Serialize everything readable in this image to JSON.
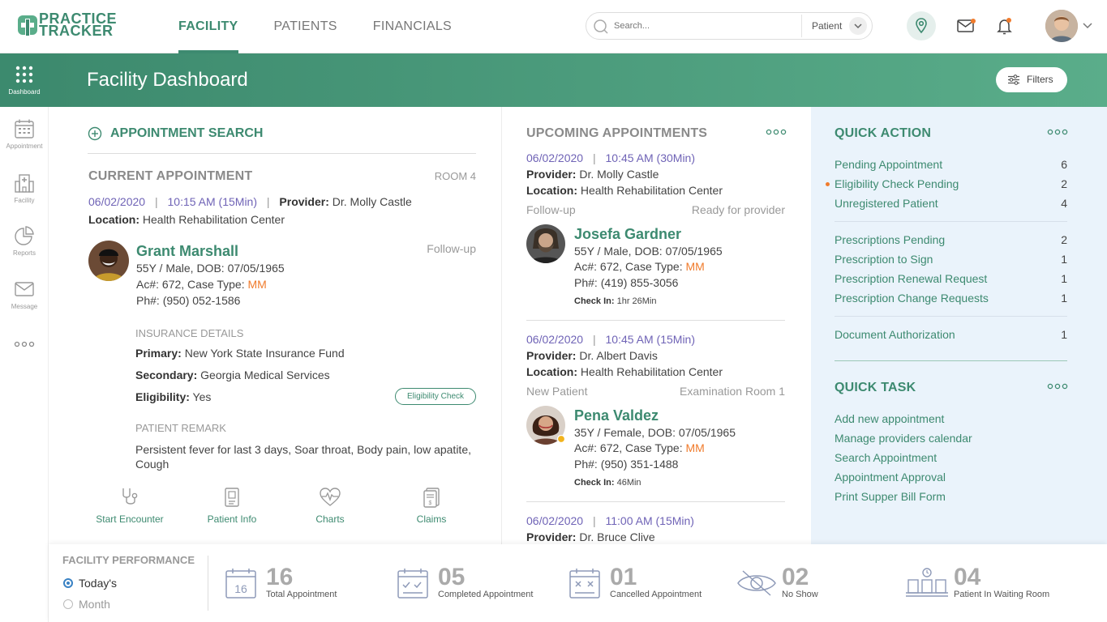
{
  "brand": {
    "line1": "PRACTICE",
    "line2": "TRACKER"
  },
  "nav": [
    {
      "label": "FACILITY",
      "active": true
    },
    {
      "label": "PATIENTS",
      "active": false
    },
    {
      "label": "FINANCIALS",
      "active": false
    }
  ],
  "search": {
    "placeholder": "Search...",
    "type": "Patient"
  },
  "sidebar": {
    "items": [
      {
        "label": "Dashboard",
        "icon": "grid-icon",
        "active": true
      },
      {
        "label": "Appointment",
        "icon": "calendar-icon"
      },
      {
        "label": "Facility",
        "icon": "hospital-icon"
      },
      {
        "label": "Reports",
        "icon": "pie-chart-icon"
      },
      {
        "label": "Message",
        "icon": "mail-icon"
      }
    ]
  },
  "header": {
    "title": "Facility Dashboard",
    "filters_label": "Filters"
  },
  "left": {
    "appt_search": "APPOINTMENT SEARCH",
    "current_title": "CURRENT APPOINTMENT",
    "room": "ROOM 4",
    "date": "06/02/2020",
    "time": "10:15 AM (15Min)",
    "provider_label": "Provider:",
    "provider": "Dr. Molly Castle",
    "location_label": "Location:",
    "location": "Health Rehabilitation Center",
    "patient": {
      "name": "Grant Marshall",
      "visit_type": "Follow-up",
      "demographics": "55Y / Male, DOB: 07/05/1965",
      "account": "Ac#: 672, Case Type: ",
      "case_type": "MM",
      "phone": "Ph#: (950) 052-1586"
    },
    "insurance": {
      "title": "INSURANCE DETAILS",
      "primary_label": "Primary:",
      "primary": "New York State Insurance Fund",
      "secondary_label": "Secondary:",
      "secondary": "Georgia Medical Services",
      "eligibility_label": "Eligibility:",
      "eligibility": "Yes",
      "check_button": "Eligibility Check"
    },
    "remark": {
      "title": "PATIENT REMARK",
      "text": "Persistent fever for last 3 days, Soar throat, Body pain, low apatite, Cough"
    },
    "actions": [
      {
        "label": "Start Encounter",
        "icon": "stethoscope-icon"
      },
      {
        "label": "Patient Info",
        "icon": "id-card-icon"
      },
      {
        "label": "Charts",
        "icon": "heart-pulse-icon"
      },
      {
        "label": "Claims",
        "icon": "receipt-icon"
      }
    ]
  },
  "upcoming": {
    "title": "UPCOMING APPOINTMENTS",
    "appointments": [
      {
        "date": "06/02/2020",
        "time": "10:45 AM (30Min)",
        "provider_label": "Provider:",
        "provider": "Dr. Molly Castle",
        "location_label": "Location:",
        "location": "Health Rehabilitation Center",
        "visit_type": "Follow-up",
        "status": "Ready for provider",
        "name": "Josefa Gardner",
        "demographics": "55Y / Male, DOB: 07/05/1965",
        "account": "Ac#: 672, Case Type: ",
        "case_type": "MM",
        "phone": "Ph#: (419) 855-3056",
        "checkin_label": "Check In:",
        "checkin": "1hr 26Min"
      },
      {
        "date": "06/02/2020",
        "time": "10:45 AM (15Min)",
        "provider_label": "Provider:",
        "provider": "Dr. Albert Davis",
        "location_label": "Location:",
        "location": "Health Rehabilitation Center",
        "visit_type": "New Patient",
        "status": "Examination Room 1",
        "name": "Pena Valdez",
        "demographics": "35Y / Female, DOB: 07/05/1965",
        "account": "Ac#: 672, Case Type: ",
        "case_type": "MM",
        "phone": "Ph#: (950) 351-1488",
        "checkin_label": "Check In:",
        "checkin": "46Min"
      },
      {
        "date": "06/02/2020",
        "time": "11:00 AM (15Min)",
        "provider_label": "Provider:",
        "provider": "Dr. Bruce Clive"
      }
    ]
  },
  "quick_action": {
    "title": "QUICK ACTION",
    "items": [
      {
        "label": "Pending Appointment",
        "count": "6"
      },
      {
        "label": "Eligibility Check Pending",
        "count": "2",
        "alert": true
      },
      {
        "label": "Unregistered Patient",
        "count": "4"
      },
      {
        "label": "Prescriptions Pending",
        "count": "2"
      },
      {
        "label": "Prescription to Sign",
        "count": "1"
      },
      {
        "label": "Prescription Renewal Request",
        "count": "1"
      },
      {
        "label": "Prescription Change Requests",
        "count": "1"
      },
      {
        "label": "Document Authorization",
        "count": "1"
      }
    ]
  },
  "quick_task": {
    "title": "QUICK TASK",
    "items": [
      "Add new appointment",
      "Manage providers calendar",
      "Search Appointment",
      "Appointment Approval",
      "Print Supper Bill Form"
    ]
  },
  "performance": {
    "title": "FACILITY PERFORMANCE",
    "periods": [
      {
        "label": "Today's",
        "selected": true
      },
      {
        "label": "Month",
        "selected": false
      }
    ],
    "stats": [
      {
        "value": "16",
        "label": "Total Appointment",
        "icon": "calendar-16-icon",
        "icon_text": "16"
      },
      {
        "value": "05",
        "label": "Completed Appointment",
        "icon": "calendar-check-icon"
      },
      {
        "value": "01",
        "label": "Cancelled Appointment",
        "icon": "calendar-cross-icon"
      },
      {
        "value": "02",
        "label": "No Show",
        "icon": "eye-off-icon"
      },
      {
        "value": "04",
        "label": "Patient In Waiting Room",
        "icon": "waiting-room-icon"
      }
    ]
  },
  "colors": {
    "brand": "#3d8a70",
    "accent_purple": "#6f63b6",
    "accent_orange": "#f07b2c",
    "panel_right": "#eaf3fb"
  }
}
